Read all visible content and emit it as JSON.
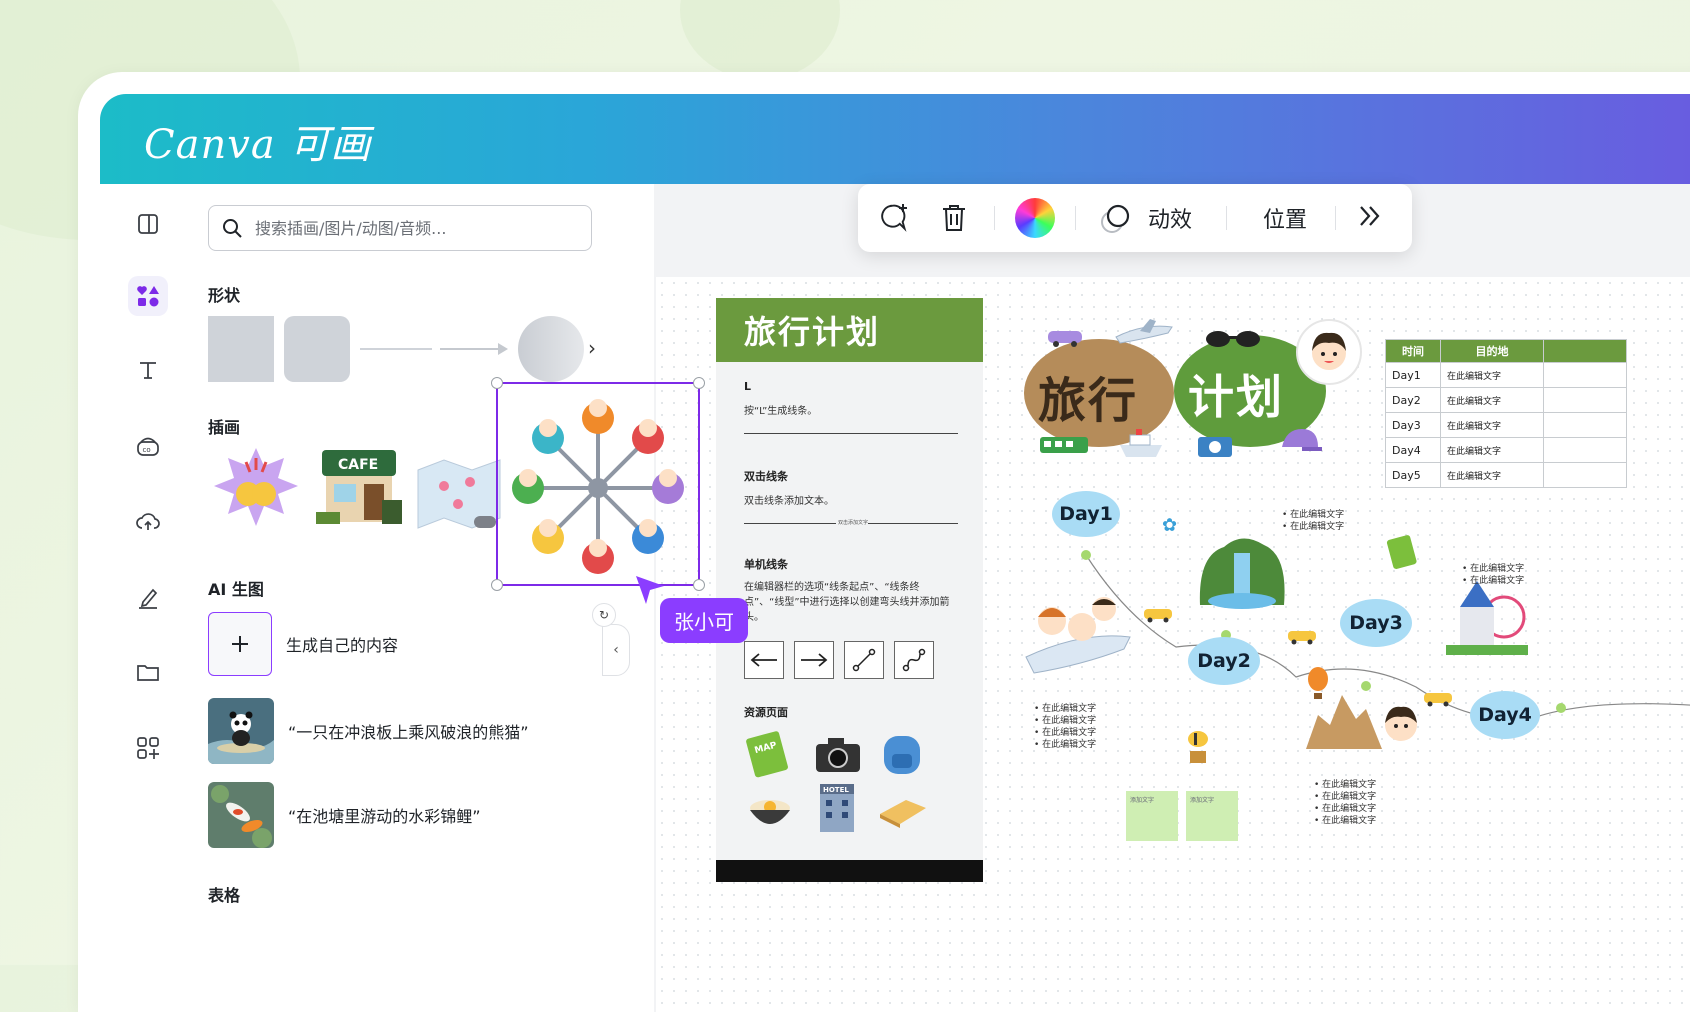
{
  "brand": {
    "logo": "Canva 可画"
  },
  "rail": {
    "items": [
      "layout",
      "elements",
      "text",
      "brand",
      "uploads",
      "draw",
      "projects",
      "apps"
    ]
  },
  "panel": {
    "search_placeholder": "搜索插画/图片/动图/音频...",
    "shapes_title": "形状",
    "illustrations_title": "插画",
    "ai_title": "AI 生图",
    "generate_label": "生成自己的内容",
    "ai_items": [
      "“一只在冲浪板上乘风破浪的熊猫”",
      "“在池塘里游动的水彩锦鲤”"
    ],
    "table_title": "表格"
  },
  "toolbar": {
    "animate_label": "动效",
    "position_label": "位置"
  },
  "collaborator": {
    "name": "张小可"
  },
  "sheet": {
    "title": "旅行计划",
    "s1_label": "L",
    "s1_text": "按“L”生成线条。",
    "s2_label": "双击线条",
    "s2_text": "双击线条添加文本。",
    "s2_mid": "双击添加文字",
    "s3_label": "单机线条",
    "s3_text": "在编辑器栏的选项“线条起点”、“线条终点”、“线型”中进行选择以创建弯头线并添加箭头。",
    "s4_label": "资源页面"
  },
  "plan": {
    "title_left": "旅行",
    "title_right": "计划",
    "table_headers": [
      "时间",
      "目的地"
    ],
    "table_rows": [
      [
        "Day1",
        "在此编辑文字"
      ],
      [
        "Day2",
        "在此编辑文字"
      ],
      [
        "Day3",
        "在此编辑文字"
      ],
      [
        "Day4",
        "在此编辑文字"
      ],
      [
        "Day5",
        "在此编辑文字"
      ]
    ],
    "days": [
      "Day1",
      "Day2",
      "Day3",
      "Day4"
    ],
    "bullet": "• 在此编辑文字",
    "sticky": "添加文字"
  },
  "colors": {
    "accent": "#7d2ae8",
    "green": "#6b9a3e",
    "bubble": "#a9dcf5"
  }
}
